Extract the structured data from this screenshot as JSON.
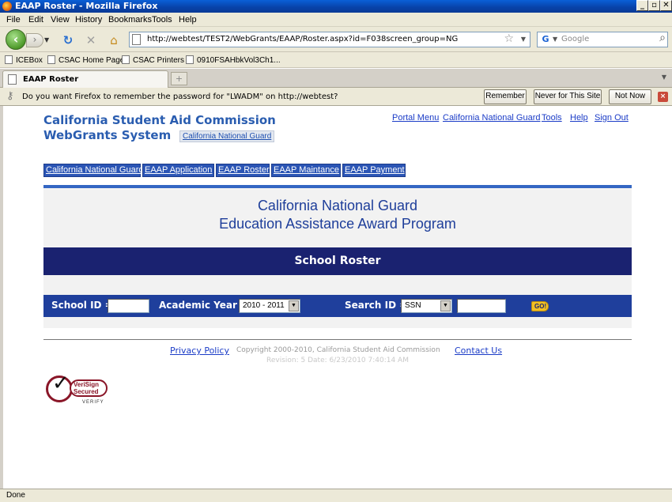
{
  "window": {
    "title": "EAAP Roster - Mozilla Firefox",
    "min_btn": "_",
    "max_btn": "▫",
    "close_btn": "✕"
  },
  "menubar": [
    "File",
    "Edit",
    "View",
    "History",
    "Bookmarks",
    "Tools",
    "Help"
  ],
  "navbar": {
    "url": "http://webtest/TEST2/WebGrants/EAAP/Roster.aspx?id=F038screen_group=NG",
    "search_placeholder": "Google",
    "search_engine_icon": "G"
  },
  "bookmarks": [
    "ICEBox",
    "CSAC Home Page",
    "CSAC Printers",
    "0910FSAHbkVol3Ch1..."
  ],
  "tabs": [
    {
      "label": "EAAP Roster"
    }
  ],
  "password_bar": {
    "message": "Do you want Firefox to remember the password for \"LWADM\" on http://webtest?",
    "remember": "Remember",
    "never": "Never for This Site",
    "not_now": "Not Now"
  },
  "status": "Done",
  "page": {
    "site_title": "California Student Aid Commission",
    "site_subtitle": "WebGrants System",
    "group_badge": "California National Guard",
    "top_links": [
      "Portal Menu",
      "California National Guard",
      "Tools",
      "Help",
      "Sign Out"
    ],
    "nav_tabs": [
      "California National Guard",
      "EAAP Application",
      "EAAP Roster",
      "EAAP Maintance",
      "EAAP Payment"
    ],
    "hero_line1": "California National Guard",
    "hero_line2": "Education Assistance Award Program",
    "section_title": "School Roster",
    "search": {
      "school_id_label": "School ID =",
      "school_id_value": "",
      "academic_year_label": "Academic Year =",
      "academic_year_value": "2010 - 2011",
      "search_id_label": "Search ID =",
      "search_id_type": "SSN",
      "search_id_value": "",
      "go_label": "GO!"
    },
    "footer": {
      "privacy": "Privacy Policy",
      "copyright": "Copyright 2000-2010, California Student Aid Commission",
      "contact": "Contact Us",
      "revision": "Revision: 5 Date: 6/23/2010 7:40:14 AM"
    },
    "verisign": {
      "line1": "VeriSign",
      "line2": "Secured",
      "line3": "VERIFY"
    }
  }
}
